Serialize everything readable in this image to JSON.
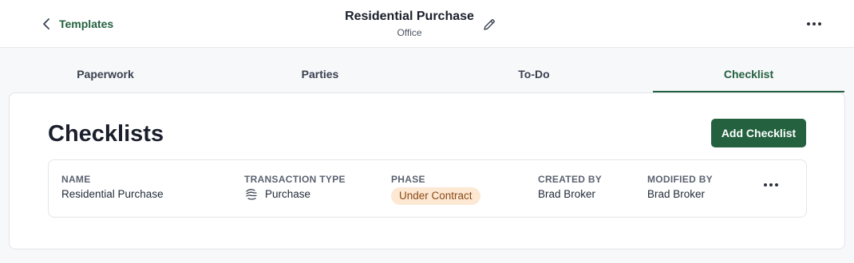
{
  "header": {
    "back_label": "Templates",
    "title": "Residential Purchase",
    "subtitle": "Office"
  },
  "tabs": [
    {
      "label": "Paperwork",
      "active": false
    },
    {
      "label": "Parties",
      "active": false
    },
    {
      "label": "To-Do",
      "active": false
    },
    {
      "label": "Checklist",
      "active": true
    }
  ],
  "main": {
    "title": "Checklists",
    "add_button": "Add Checklist",
    "columns": {
      "name": "NAME",
      "transaction_type": "TRANSACTION TYPE",
      "phase": "PHASE",
      "created_by": "CREATED BY",
      "modified_by": "MODIFIED BY"
    },
    "rows": [
      {
        "name": "Residential Purchase",
        "transaction_type": "Purchase",
        "phase": "Under Contract",
        "created_by": "Brad Broker",
        "modified_by": "Brad Broker"
      }
    ]
  },
  "icons": {
    "back": "chevron-left-icon",
    "edit": "pencil-icon",
    "more": "more-horizontal-icon",
    "transaction_type": "purchase-icon"
  },
  "colors": {
    "brand": "#23603f",
    "badge_bg": "#fde8d3",
    "badge_text": "#8a4a16",
    "page_bg": "#f7f8fa"
  }
}
